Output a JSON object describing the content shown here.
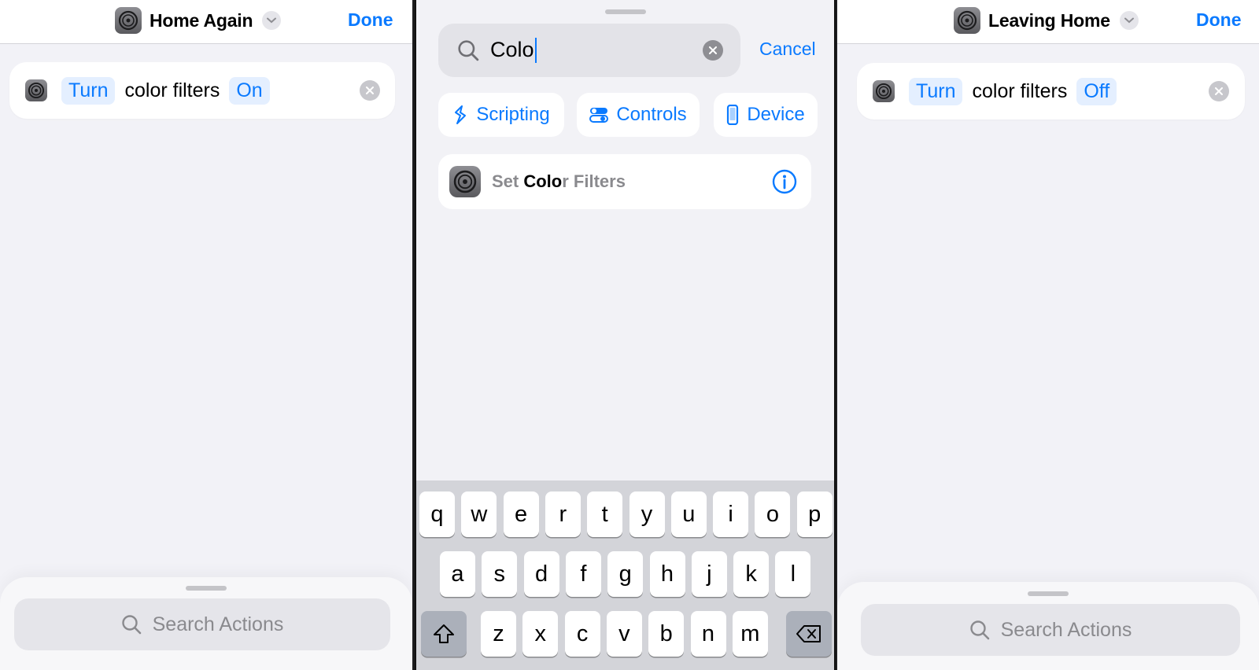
{
  "left": {
    "title": "Home Again",
    "done_label": "Done",
    "action": {
      "verb": "Turn",
      "object": "color filters",
      "state": "On"
    },
    "search_placeholder": "Search Actions"
  },
  "middle": {
    "search_query": "Colo",
    "cancel_label": "Cancel",
    "chips": [
      {
        "label": "Scripting",
        "icon": "scripting-icon"
      },
      {
        "label": "Controls",
        "icon": "toggles-icon"
      },
      {
        "label": "Device",
        "icon": "phone-icon"
      }
    ],
    "result": {
      "prefix": "Set ",
      "match": "Colo",
      "suffix": "r Filters"
    },
    "keyboard": {
      "row1": [
        "q",
        "w",
        "e",
        "r",
        "t",
        "y",
        "u",
        "i",
        "o",
        "p"
      ],
      "row2": [
        "a",
        "s",
        "d",
        "f",
        "g",
        "h",
        "j",
        "k",
        "l"
      ],
      "row3": [
        "z",
        "x",
        "c",
        "v",
        "b",
        "n",
        "m"
      ]
    }
  },
  "right": {
    "title": "Leaving Home",
    "done_label": "Done",
    "action": {
      "verb": "Turn",
      "object": "color filters",
      "state": "Off"
    },
    "search_placeholder": "Search Actions"
  },
  "colors": {
    "accent": "#0a7aff",
    "token_bg": "#e4efff",
    "keyboard_bg": "#d3d4d9"
  }
}
